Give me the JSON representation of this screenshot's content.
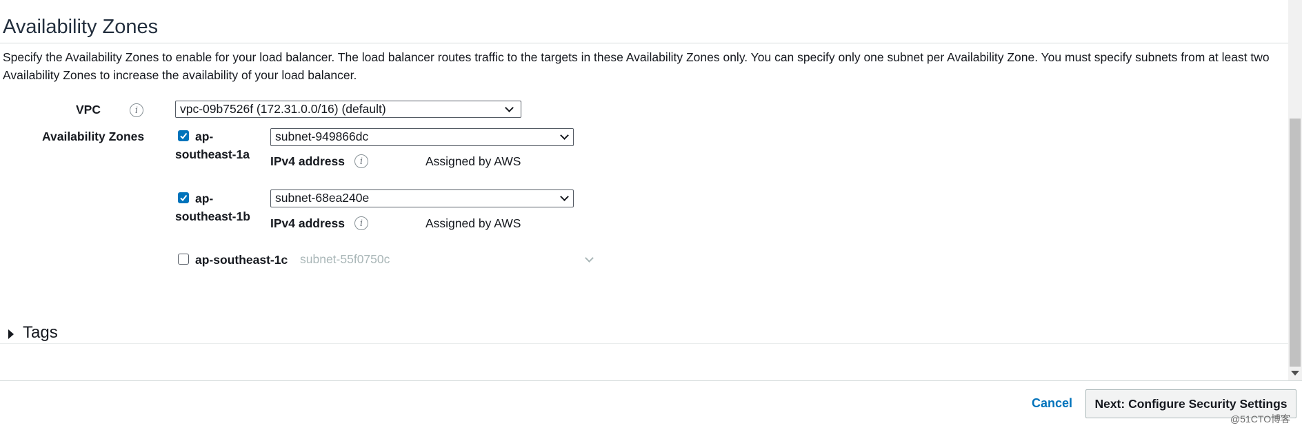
{
  "section": {
    "title": "Availability Zones",
    "description": "Specify the Availability Zones to enable for your load balancer. The load balancer routes traffic to the targets in these Availability Zones only. You can specify only one subnet per Availability Zone. You must specify subnets from at least two Availability Zones to increase the availability of your load balancer."
  },
  "vpc": {
    "label": "VPC",
    "selected": "vpc-09b7526f (172.31.0.0/16) (default)"
  },
  "zones": {
    "label": "Availability Zones",
    "items": [
      {
        "name_line1": "ap-",
        "name_line2": "southeast-1a",
        "checked": true,
        "subnet": "subnet-949866dc",
        "ipv4_label": "IPv4 address",
        "ipv4_value": "Assigned by AWS"
      },
      {
        "name_line1": "ap-",
        "name_line2": "southeast-1b",
        "checked": true,
        "subnet": "subnet-68ea240e",
        "ipv4_label": "IPv4 address",
        "ipv4_value": "Assigned by AWS"
      },
      {
        "name": "ap-southeast-1c",
        "checked": false,
        "subnet": "subnet-55f0750c"
      }
    ]
  },
  "tags": {
    "label": "Tags"
  },
  "footer": {
    "cancel_label": "Cancel",
    "next_label": "Next: Configure Security Settings"
  },
  "watermark": "@51CTO博客",
  "icons": {
    "info": "info-icon",
    "chevron": "chevron-down-icon",
    "caret": "caret-right-icon",
    "check": "check-icon"
  },
  "colors": {
    "accent": "#0073bb",
    "text": "#16191f",
    "disabled": "#aab7b8"
  }
}
